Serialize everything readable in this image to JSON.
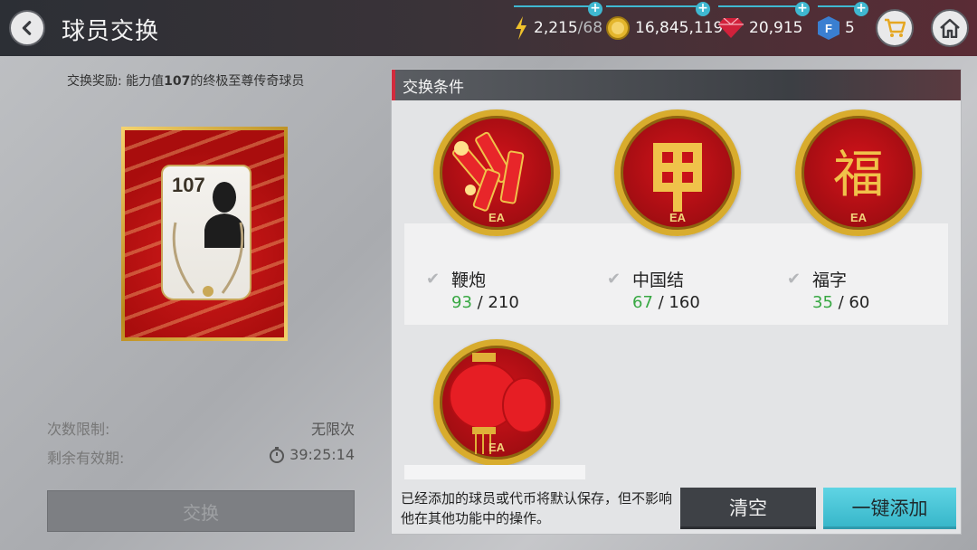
{
  "header": {
    "title": "球员交换",
    "energy": {
      "value": "2,215",
      "max": "/68"
    },
    "coins": "16,845,119",
    "gems": "20,915",
    "fifa_points": "5"
  },
  "left": {
    "reward_prefix": "交换奖励: 能力值",
    "reward_rating": "107",
    "reward_suffix": "的终极至尊传奇球员",
    "card_rating": "107",
    "limit_label": "次数限制:",
    "limit_value": "无限次",
    "validity_label": "剩余有效期:",
    "validity_value": "39:25:14",
    "exchange_button": "交换"
  },
  "conditions": {
    "header": "交换条件",
    "badge_logo": "EA",
    "items": [
      {
        "name": "鞭炮",
        "have": "93",
        "need": " / 210"
      },
      {
        "name": "中国结",
        "have": "67",
        "need": " / 160"
      },
      {
        "name": "福字",
        "have": "35",
        "need": " / 60"
      }
    ],
    "fu_char": "福",
    "note": "已经添加的球员或代币将默认保存，但不影响他在其他功能中的操作。",
    "clear_button": "清空",
    "add_button": "一键添加"
  }
}
